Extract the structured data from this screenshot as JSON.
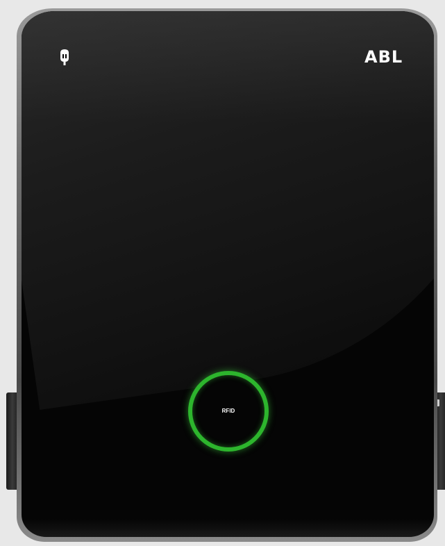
{
  "device": {
    "brand_logo": "ABL",
    "rfid_label": "RFID",
    "ring_color": "#2db52d",
    "body_color": "#050505",
    "background_color": "#e8e8e8",
    "icons": {
      "top_left": "plug-logo-icon"
    }
  }
}
